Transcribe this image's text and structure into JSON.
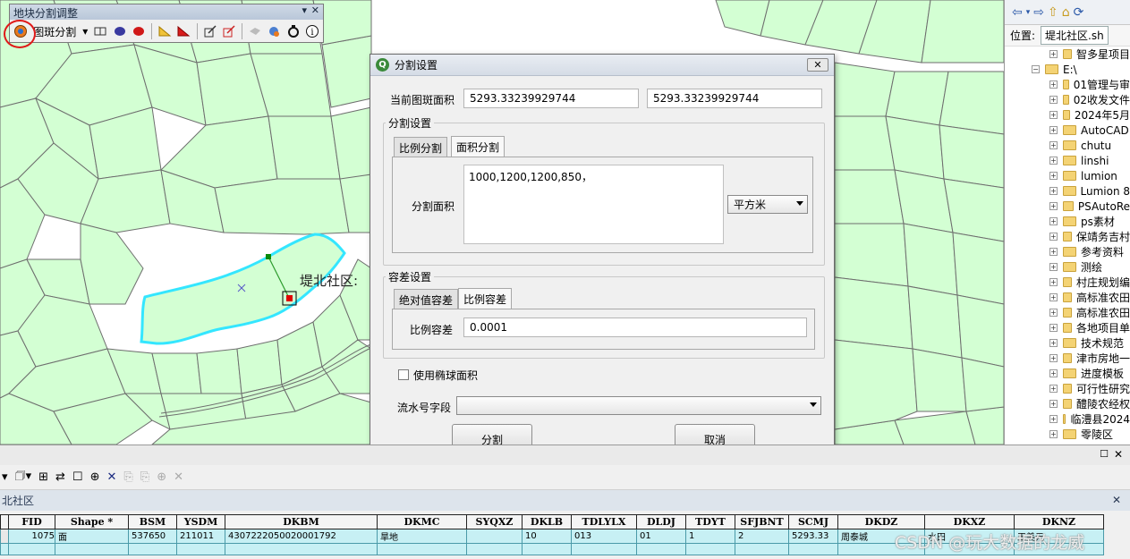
{
  "map": {
    "label": "堤北社区:",
    "colors": {
      "parcel_fill": "#d3ffd3",
      "parcel_stroke": "#6e6e6e",
      "selected_outline": "#34e6ff"
    }
  },
  "toolbar": {
    "title": "地块分割调整",
    "ctl_pin": "▾",
    "ctl_close": "✕",
    "split_label": "图斑分割",
    "split_arrow": "▾"
  },
  "catalog": {
    "location_label": "位置:",
    "location_value": "堤北社区.sh",
    "items": [
      {
        "label": "智多星项目",
        "expand": "⊞",
        "indent": 0
      },
      {
        "label": "E:\\",
        "expand": "⊟",
        "indent": -1
      },
      {
        "label": "01管理与审",
        "expand": "⊞",
        "indent": 0
      },
      {
        "label": "02收发文件",
        "expand": "⊞",
        "indent": 0
      },
      {
        "label": "2024年5月",
        "expand": "⊞",
        "indent": 0
      },
      {
        "label": "AutoCAD",
        "expand": "⊞",
        "indent": 0
      },
      {
        "label": "chutu",
        "expand": "⊞",
        "indent": 0
      },
      {
        "label": "linshi",
        "expand": "⊞",
        "indent": 0
      },
      {
        "label": "lumion",
        "expand": "⊞",
        "indent": 0
      },
      {
        "label": "Lumion 8",
        "expand": "⊞",
        "indent": 0
      },
      {
        "label": "PSAutoRe",
        "expand": "⊞",
        "indent": 0
      },
      {
        "label": "ps素材",
        "expand": "⊞",
        "indent": 0
      },
      {
        "label": "保靖务吉村",
        "expand": "⊞",
        "indent": 0
      },
      {
        "label": "参考资料",
        "expand": "⊞",
        "indent": 0
      },
      {
        "label": "测绘",
        "expand": "⊞",
        "indent": 0
      },
      {
        "label": "村庄规划编",
        "expand": "⊞",
        "indent": 0
      },
      {
        "label": "高标准农田",
        "expand": "⊞",
        "indent": 0
      },
      {
        "label": "高标准农田",
        "expand": "⊞",
        "indent": 0
      },
      {
        "label": "各地项目单",
        "expand": "⊞",
        "indent": 0
      },
      {
        "label": "技术规范",
        "expand": "⊞",
        "indent": 0
      },
      {
        "label": "津市房地一",
        "expand": "⊞",
        "indent": 0
      },
      {
        "label": "进度模板",
        "expand": "⊞",
        "indent": 0
      },
      {
        "label": "可行性研究",
        "expand": "⊞",
        "indent": 0
      },
      {
        "label": "醴陵农经权",
        "expand": "⊞",
        "indent": 0
      },
      {
        "label": "临澧县2024",
        "expand": "⊞",
        "indent": 0
      },
      {
        "label": "零陵区",
        "expand": "⊞",
        "indent": 0
      }
    ]
  },
  "dialog": {
    "title": "分割设置",
    "close": "✕",
    "current_area_label": "当前图斑面积",
    "current_area_1": "5293.33239929744",
    "current_area_2": "5293.33239929744",
    "split_group_title": "分割设置",
    "tabs_split": [
      {
        "label": "比例分割"
      },
      {
        "label": "面积分割"
      }
    ],
    "split_area_label": "分割面积",
    "split_area_value": "1000,1200,1200,850，",
    "unit_value": "平方米",
    "tolerance_group_title": "容差设置",
    "tabs_tolerance": [
      {
        "label": "绝对值容差"
      },
      {
        "label": "比例容差"
      }
    ],
    "ratio_tol_label": "比例容差",
    "ratio_tol_value": "0.0001",
    "ellipsoid_label": "使用椭球面积",
    "serial_label": "流水号字段",
    "serial_value": "",
    "split_btn": "分割",
    "cancel_btn": "取消"
  },
  "attr": {
    "close": "✕",
    "tab_label": "北社区",
    "columns": [
      "FID",
      "Shape *",
      "BSM",
      "YSDM",
      "DKBM",
      "DKMC",
      "SYQXZ",
      "DKLB",
      "TDLYLX",
      "DLDJ",
      "TDYT",
      "SFJBNT",
      "SCMJ",
      "DKDZ",
      "DKXZ",
      "DKNZ"
    ],
    "rows": [
      [
        "1075",
        "面",
        "537650",
        "211011",
        "430722205002000179​2",
        "旱地",
        "",
        "10",
        "013",
        "01",
        "1",
        "2",
        "5293.33",
        "周泰城",
        "水田",
        "王美元"
      ]
    ]
  },
  "watermark": "CSDN @玩大数据的龙威"
}
